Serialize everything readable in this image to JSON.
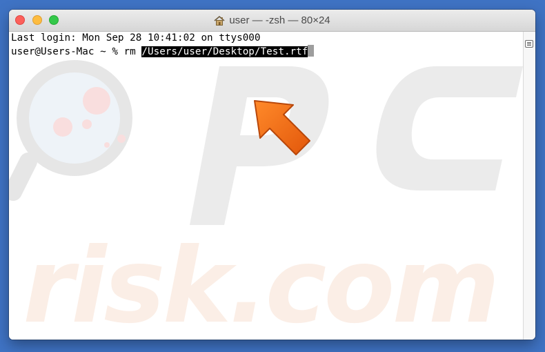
{
  "window": {
    "title": "user — -zsh — 80×24",
    "title_icon": "home-icon"
  },
  "terminal": {
    "lines": [
      "Last login: Mon Sep 28 10:41:02 on ttys000"
    ],
    "prompt": "user@Users-Mac ~ % rm ",
    "selected_path": "/Users/user/Desktop/Test.rtf"
  },
  "watermark": {
    "brand_top": "PC",
    "brand_bottom": "risk.com"
  },
  "colors": {
    "desktop": "#3f73c4",
    "arrow": "#f26a16",
    "watermark": "#e9e9e9",
    "watermark_accent": "#f7d2d2"
  }
}
